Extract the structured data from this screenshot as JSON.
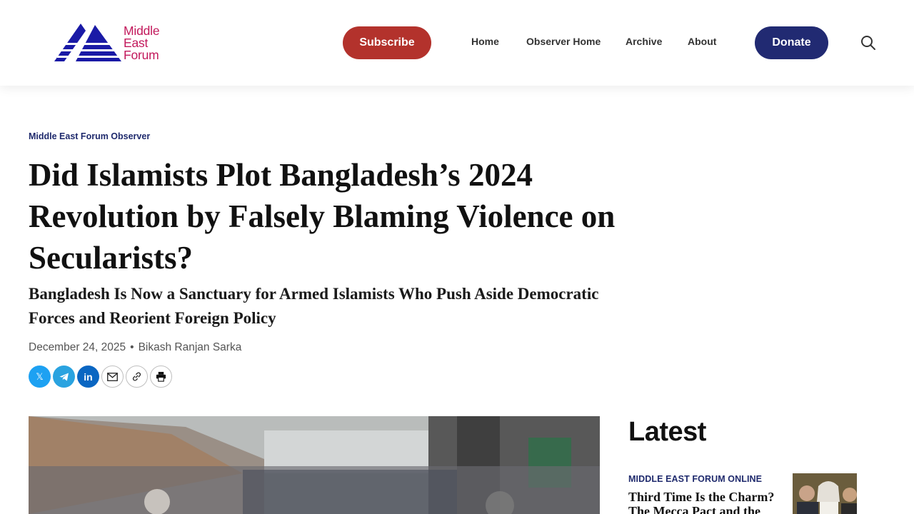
{
  "header": {
    "logo": {
      "line1": "Middle",
      "line2": "East",
      "line3": "Forum"
    },
    "subscribe_label": "Subscribe",
    "nav": [
      "Home",
      "Observer Home",
      "Archive",
      "About"
    ],
    "donate_label": "Donate",
    "search_icon": "search-icon"
  },
  "colors": {
    "brand_navy": "#212a72",
    "subscribe_red": "#b3322c",
    "logo_pink": "#c2185b",
    "logo_blue": "#1a1aa6",
    "kicker_navy": "#1f2a6d"
  },
  "article": {
    "kicker": "Middle East Forum Observer",
    "title": "Did Islamists Plot Bangladesh’s 2024 Revolution by Falsely Blaming Violence on Secularists?",
    "subtitle": "Bangladesh Is Now a Sanctuary for Armed Islamists Who Push Aside Democratic Forces and Reorient Foreign Policy",
    "date": "December 24, 2025",
    "separator": "•",
    "author": "Bikash Ranjan Sarka",
    "share": {
      "x_glyph": "𝕏",
      "linkedin_glyph": "in",
      "icons": [
        "x-icon",
        "telegram-icon",
        "linkedin-icon",
        "email-icon",
        "link-icon",
        "print-icon"
      ]
    }
  },
  "sidebar": {
    "heading": "Latest",
    "items": [
      {
        "category": "MIDDLE EAST FORUM ONLINE",
        "title": "Third Time Is the Charm? The Mecca Pact and the Sad"
      }
    ]
  }
}
